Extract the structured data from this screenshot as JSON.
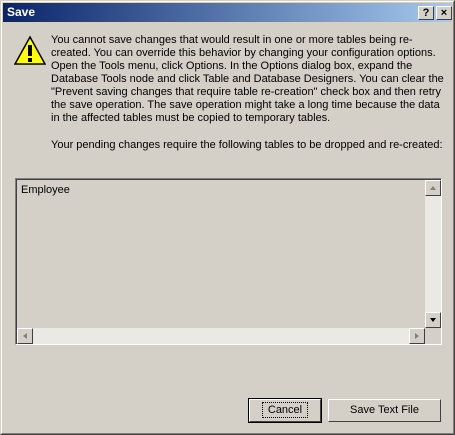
{
  "window": {
    "title": "Save"
  },
  "titlebar": {
    "help_glyph": "?",
    "close_glyph": "×"
  },
  "icons": {
    "warning": "warning-icon",
    "close": "close-icon",
    "help": "help-icon"
  },
  "message": {
    "body": "You cannot save changes that would result in one or more tables being re-created. You can override this behavior by changing your configuration options. Open the Tools menu, click Options. In the Options dialog box, expand the Database Tools node and click Table and Database Designers. You can clear the \"Prevent saving changes that require table re-creation\" check box and then retry the save operation. The save operation might take a long time because the data in the affected tables must be copied to temporary tables.",
    "pending": "Your pending changes require the following tables to be dropped and re-created:"
  },
  "tables": [
    {
      "name": "Employee"
    }
  ],
  "buttons": {
    "cancel": "Cancel",
    "save_text_file": "Save Text File"
  },
  "colors": {
    "title_start": "#0a246a",
    "title_end": "#a6caf0",
    "face": "#d4d0c8"
  }
}
